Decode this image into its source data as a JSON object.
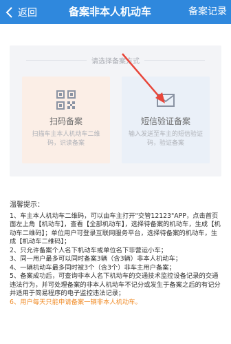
{
  "header": {
    "back_label": "返回",
    "title": "备案非本人机动车",
    "records_label": "备案记录"
  },
  "chooser": {
    "prompt": "请选择备案方式",
    "options": [
      {
        "title": "扫码备案",
        "desc": "扫描车主本人机动车二维码，识读备案",
        "icon": "qr-code-icon"
      },
      {
        "title": "短信验证备案",
        "desc": "输入发送至车主的短信验证码，验证备案",
        "icon": "envelope-icon"
      }
    ]
  },
  "tips": {
    "heading": "温馨提示：",
    "items": [
      "1、车主本人机动车二维码，可以由车主打开\"交管12123\"APP，点击首页面左上角【机动车】，查看【全部机动车】，选择待备案的机动车，生成【机动车二维码】；单位用户可登录互联网服务平台，选择待备案的机动车，生成【机动车二维码】；",
      "2、只允许备案个人名下机动车或单位名下非营运小车；",
      "3、同一用户最多可以同时备案3辆（含3辆）非本人机动车；",
      "4、一辆机动车最多同时被3个（含3个）非车主用户备案；",
      "5、备案成功后，可查询非本人名下机动车的交通技术监控设备记录的交通违法行为，并可处理备案的非本人机动车不记分或发生于备案之后的有记分并适用于简易程序的电子监控违法记录；",
      "6、用户每天只能申请备案一辆非本人机动车。"
    ],
    "warn_color": "#f08c28"
  },
  "colors": {
    "accent": "#2f88dd",
    "arrow": "#e8463a"
  }
}
